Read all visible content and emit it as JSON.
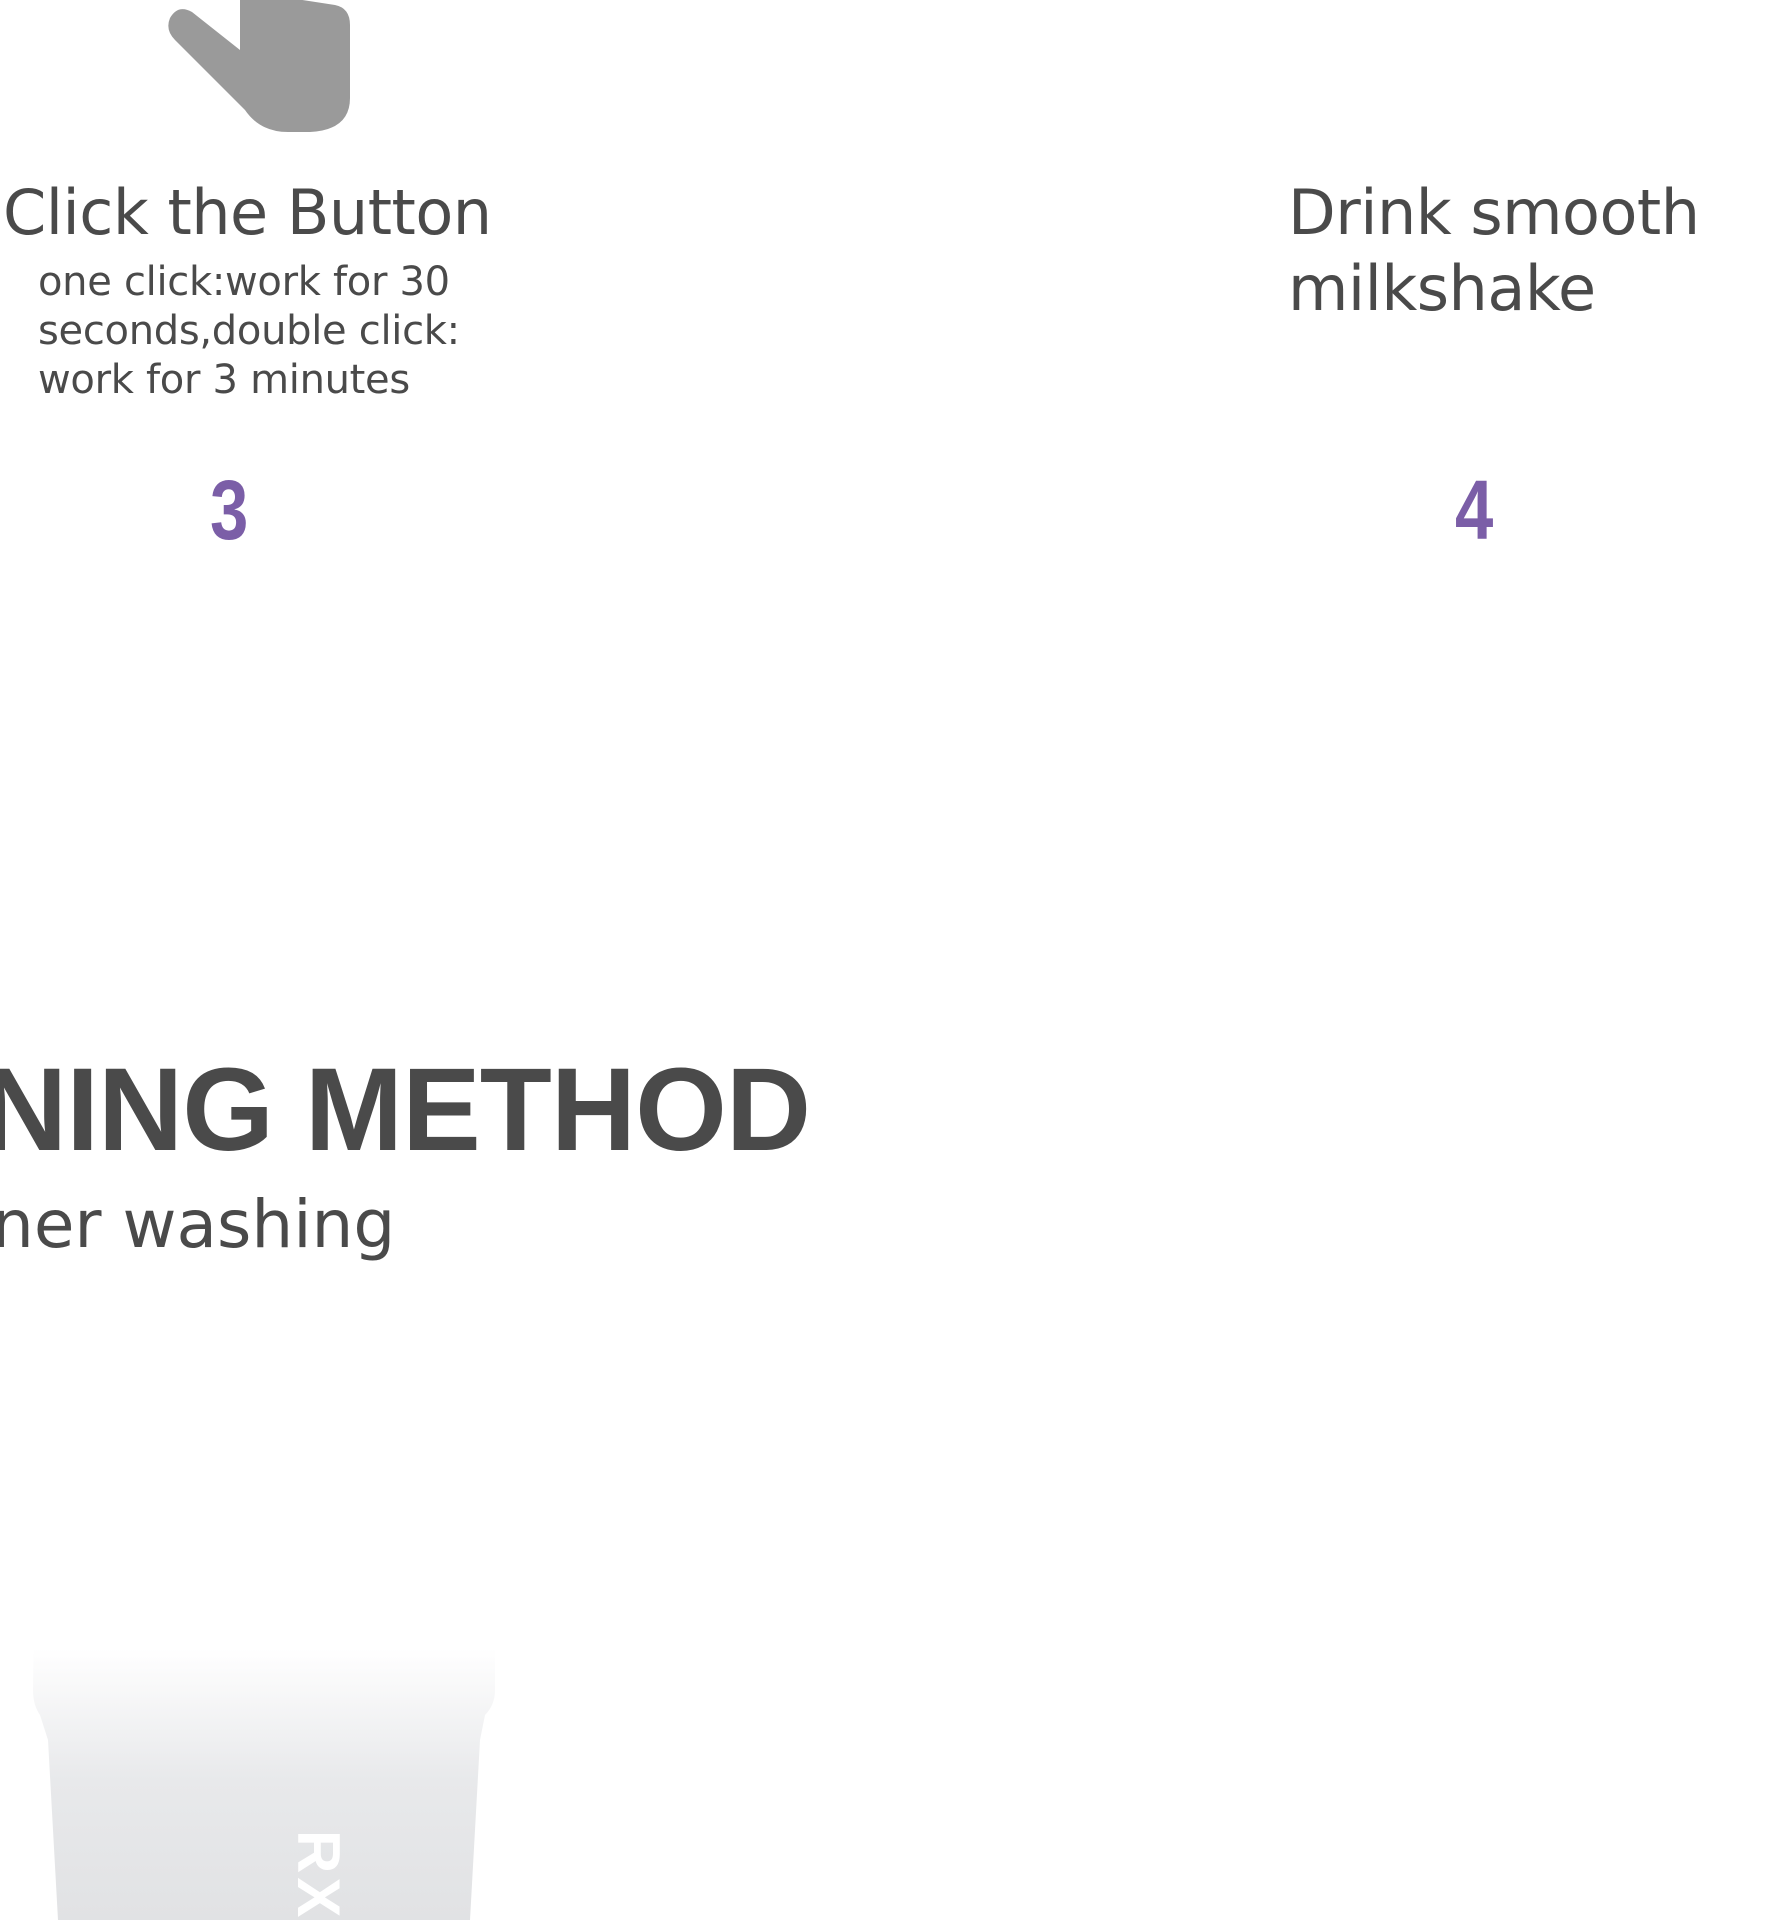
{
  "steps": [
    {
      "number": "3",
      "title": "Click the Button",
      "description_lines": [
        "one click:work for 30",
        "seconds,double click:",
        "work for 3 minutes"
      ],
      "icon": "pointing-hand-icon"
    },
    {
      "number": "4",
      "title_lines": [
        "Drink smooth",
        "milkshake"
      ]
    }
  ],
  "cleaning": {
    "heading": "NING METHOD",
    "subheading": "ner washing"
  },
  "cup": {
    "brand": "RX"
  },
  "colors": {
    "text": "#4a4a4a",
    "accent": "#7b5ea7",
    "icon": "#999999",
    "cup_body": "#e4e5e7"
  }
}
